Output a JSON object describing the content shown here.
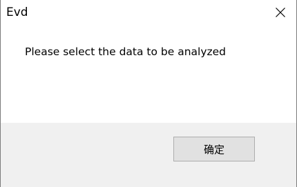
{
  "window": {
    "title": "Evd",
    "close_glyph": "✕",
    "close_icon": "close-icon"
  },
  "message": {
    "text": "Please select the data to be analyzed"
  },
  "buttons": {
    "ok_label": "确定"
  }
}
